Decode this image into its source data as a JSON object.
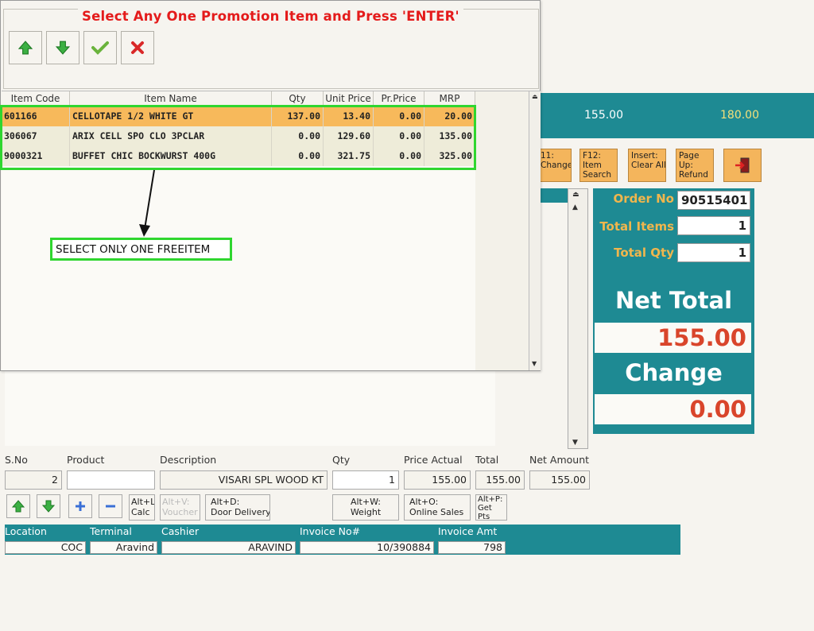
{
  "background": {
    "top_band": {
      "value1": "155.00",
      "value2": "180.00"
    },
    "function_buttons": [
      {
        "label": "11:\nChange"
      },
      {
        "label": "F12:\nItem\nSearch"
      },
      {
        "label": "Insert:\nClear All"
      },
      {
        "label": "Page\nUp:\nRefund"
      }
    ],
    "order_panel": {
      "order_no_label": "Order No",
      "order_no_value": "90515401",
      "total_items_label": "Total Items",
      "total_items_value": "1",
      "total_qty_label": "Total Qty",
      "total_qty_value": "1",
      "net_total_label": "Net Total",
      "net_total_value": "155.00",
      "change_label": "Change",
      "change_value": "0.00"
    },
    "entry": {
      "headers": [
        "S.No",
        "Product",
        "Description",
        "Qty",
        "Price Actual",
        "Total",
        "Net Amount"
      ],
      "sno": "2",
      "product": "",
      "description": "VISARI SPL WOOD KT",
      "qty": "1",
      "price_actual": "155.00",
      "total": "155.00",
      "net_amount": "155.00"
    },
    "action_buttons": {
      "calc": "Alt+L:\nCalc",
      "voucher": "Alt+V:\nVoucher",
      "door_delivery": "Alt+D:\nDoor Delivery",
      "weight": "Alt+W:\nWeight",
      "online_sales": "Alt+O:\nOnline Sales",
      "get_pts": "Alt+P:\nGet\nPts"
    },
    "footer": {
      "location_label": "Location",
      "location_value": "COC",
      "terminal_label": "Terminal",
      "terminal_value": "Aravind",
      "cashier_label": "Cashier",
      "cashier_value": "ARAVIND",
      "invoice_no_label": "Invoice No#",
      "invoice_no_value": "10/390884",
      "invoice_amt_label": "Invoice Amt",
      "invoice_amt_value": "798"
    }
  },
  "dialog": {
    "title": "Select Any One Promotion Item and Press 'ENTER'",
    "toolbar": [
      "up-arrow-icon",
      "down-arrow-icon",
      "check-icon",
      "cross-icon"
    ],
    "columns": [
      "Item Code",
      "Item Name",
      "Qty",
      "Unit Price",
      "Pr.Price",
      "MRP"
    ],
    "rows": [
      {
        "code": "601166",
        "name": "CELLOTAPE 1/2 WHITE GT",
        "qty": "137.00",
        "unit_price": "13.40",
        "pr_price": "0.00",
        "mrp": "20.00",
        "selected": true
      },
      {
        "code": "306067",
        "name": "ARIX CELL SPO CLO 3PCLAR",
        "qty": "0.00",
        "unit_price": "129.60",
        "pr_price": "0.00",
        "mrp": "135.00",
        "selected": false
      },
      {
        "code": "9000321",
        "name": "BUFFET CHIC BOCKWURST 400G",
        "qty": "0.00",
        "unit_price": "321.75",
        "pr_price": "0.00",
        "mrp": "325.00",
        "selected": false
      }
    ]
  },
  "annotation": {
    "text": "SELECT ONLY ONE FREEITEM"
  },
  "colors": {
    "teal": "#1e8a93",
    "selected_row": "#f7b95b",
    "title_red": "#e41b1b",
    "highlight_green": "#2fd62f",
    "amount_red": "#d9452b",
    "label_gold": "#f0b64d"
  }
}
